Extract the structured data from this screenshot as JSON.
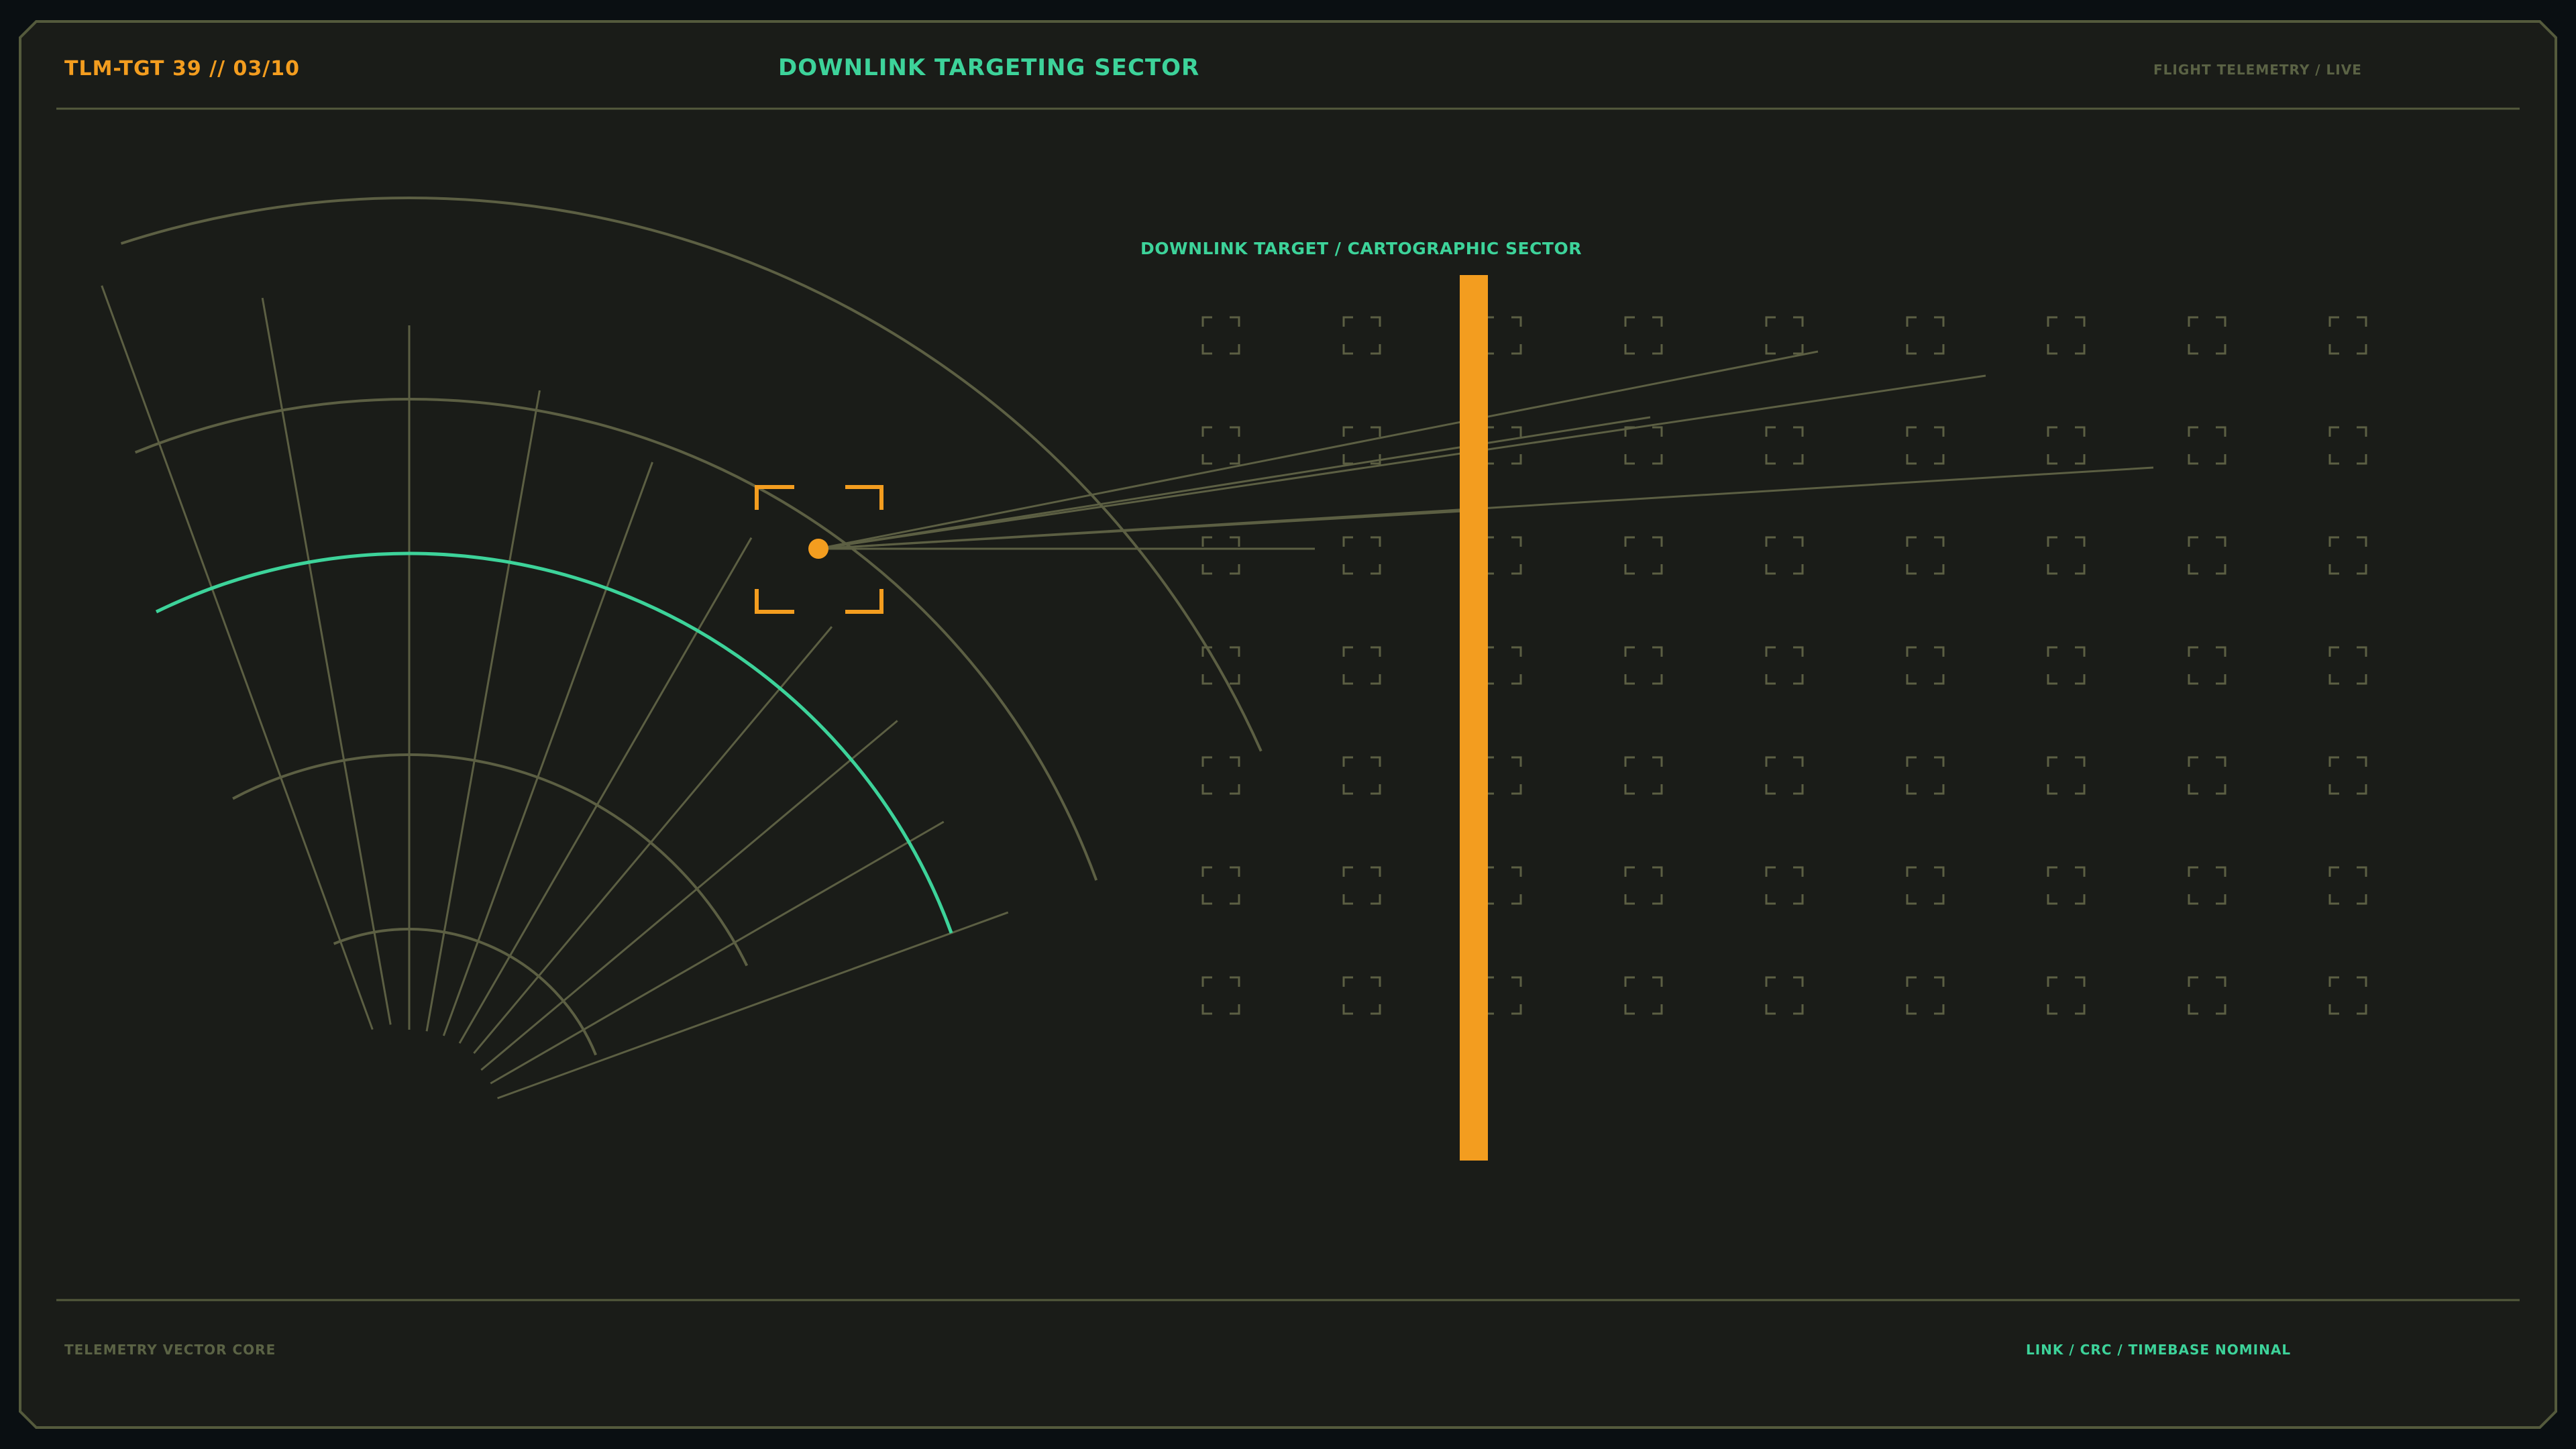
{
  "header": {
    "id_label": "TLM-TGT 39 // 03/10",
    "title": "DOWNLINK TARGETING SECTOR",
    "status": "FLIGHT TELEMETRY / LIVE"
  },
  "main": {
    "sector_label": "DOWNLINK TARGET / CARTOGRAPHIC SECTOR"
  },
  "footer": {
    "left_label": "TELEMETRY VECTOR CORE",
    "right_label": "LINK / CRC / TIMEBASE NOMINAL"
  },
  "colors": {
    "background": "#1a1c18",
    "frame": "#545a3c",
    "grid_line": "#5c5f43",
    "accent_orange": "#f39d1f",
    "accent_green": "#3dd39a",
    "muted_text": "#5b6345"
  },
  "icons": {
    "target_reticle": "target-reticle-icon",
    "target_marker": "target-marker-icon",
    "cell_bracket": "cell-bracket-icon"
  }
}
